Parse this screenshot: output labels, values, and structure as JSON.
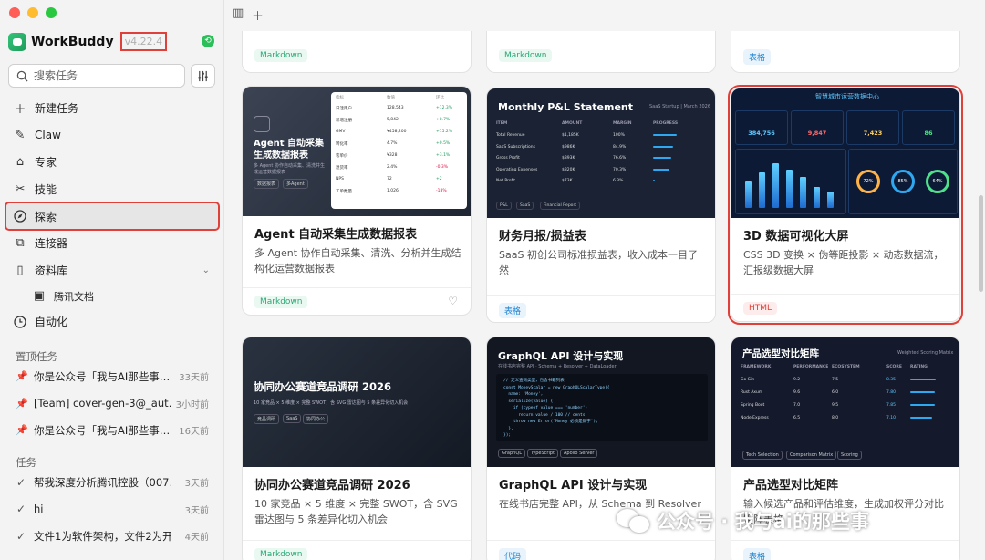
{
  "app": {
    "name": "WorkBuddy",
    "version": "v4.22.4"
  },
  "search": {
    "placeholder": "搜索任务"
  },
  "nav": [
    {
      "label": "新建任务",
      "icon": "plus-icon"
    },
    {
      "label": "Claw",
      "icon": "claw-icon"
    },
    {
      "label": "专家",
      "icon": "expert-hat-icon"
    },
    {
      "label": "技能",
      "icon": "skill-tools-icon"
    },
    {
      "label": "探索",
      "icon": "compass-icon",
      "active": true
    },
    {
      "label": "连接器",
      "icon": "connector-icon"
    },
    {
      "label": "资料库",
      "icon": "book-icon"
    },
    {
      "label": "腾讯文档",
      "icon": "doc-icon"
    },
    {
      "label": "自动化",
      "icon": "clock-icon"
    }
  ],
  "pinned": {
    "title": "置顶任务",
    "items": [
      {
        "title": "你是公众号「我与AI那些事…",
        "time": "33天前"
      },
      {
        "title": "[Team] cover-gen-3@_aut…",
        "time": "3小时前"
      },
      {
        "title": "你是公众号「我与AI那些事…",
        "time": "16天前"
      }
    ]
  },
  "tasks": {
    "title": "任务",
    "items": [
      {
        "title": "帮我深度分析腾讯控股（007…",
        "time": "3天前"
      },
      {
        "title": "hi",
        "time": "3天前"
      },
      {
        "title": "文件1为软件架构，文件2为开…",
        "time": "4天前"
      }
    ]
  },
  "top_row_tags": [
    "Markdown",
    "Markdown",
    "表格"
  ],
  "cards": [
    {
      "title": "Agent 自动采集生成数据报表",
      "desc": "多 Agent 协作自动采集、清洗、分析并生成结构化运营数据报表",
      "tag": "Markdown",
      "thumb_title": "Agent 自动采集生成数据报表",
      "thumb_sub": "多 Agent 协作自动采集、清洗并生成运营数据报表",
      "chips": [
        "数据报表",
        "多Agent"
      ],
      "table_headers": [
        "指标",
        "数值",
        "环比"
      ],
      "table_rows": [
        [
          "日活用户",
          "128,543",
          "+12.3%"
        ],
        [
          "新增注册",
          "5,842",
          "+8.7%"
        ],
        [
          "GMV",
          "¥458,200",
          "+15.2%"
        ],
        [
          "转化率",
          "4.7%",
          "+0.5%"
        ],
        [
          "客单价",
          "¥328",
          "+3.1%"
        ],
        [
          "退货率",
          "2.4%",
          "-0.3%"
        ],
        [
          "NPS",
          "72",
          "+2"
        ],
        [
          "工单数量",
          "1,026",
          "-18%"
        ]
      ]
    },
    {
      "title": "财务月报/损益表",
      "desc": "SaaS 初创公司标准损益表，收入成本一目了然",
      "tag": "表格",
      "thumb_title": "Monthly P&L Statement",
      "thumb_meta": "SaaS Startup | March 2026",
      "table_headers": [
        "ITEM",
        "AMOUNT",
        "MARGIN",
        "PROGRESS"
      ],
      "table_rows": [
        [
          "Total Revenue",
          "$1,185K",
          "100%"
        ],
        [
          "SaaS Subscriptions",
          "$986K",
          "84.9%"
        ],
        [
          "Gross Profit",
          "$893K",
          "76.6%"
        ],
        [
          "Operating Expenses",
          "$820K",
          "70.3%"
        ],
        [
          "Net Profit",
          "$73K",
          "6.3%"
        ]
      ],
      "progress": [
        1.0,
        0.849,
        0.766,
        0.703,
        0.063
      ],
      "chips": [
        "P&L",
        "SaaS",
        "Financial Report"
      ]
    },
    {
      "title": "3D 数据可视化大屏",
      "desc": "CSS 3D 变换 × 伪等距投影 × 动态数据流，汇报级数据大屏",
      "tag": "HTML",
      "highlight": true,
      "thumb_title": "智慧城市运营数据中心",
      "kpis": [
        "384,756",
        "9,847",
        "7,423",
        "86"
      ],
      "bar_levels": [
        0.55,
        0.75,
        0.95,
        0.8,
        0.65,
        0.45,
        0.35
      ],
      "rings": [
        "72%",
        "85%",
        "64%"
      ]
    },
    {
      "title": "协同办公赛道竞品调研 2026",
      "desc": "10 家竞品 × 5 维度 × 完整 SWOT，含 SVG 雷达图与 5 条差异化切入机会",
      "tag": "Markdown",
      "thumb_title": "协同办公赛道竞品调研 2026",
      "thumb_sub": "10 家竞品 × 5 维度 × 完整 SWOT，含 SVG 雷达图与 5 条差异化切入机会",
      "chips": [
        "竞品调研",
        "SaaS",
        "协同办公"
      ]
    },
    {
      "title": "GraphQL API 设计与实现",
      "desc": "在线书店完整 API，从 Schema 到 Resolver",
      "tag": "代码",
      "thumb_title": "GraphQL API 设计与实现",
      "thumb_sub": "在线书店完整 API · Schema + Resolver + DataLoader",
      "code": [
        "// 定义查询类型，包含书籍列表",
        "const MoneyScalar = new GraphQLScalarType({",
        "  name: 'Money',",
        "  serialize(value) {",
        "    if (typeof value === 'number')",
        "      return value / 100 // cents",
        "    throw new Error('Money 必须是数字');",
        "  },",
        "});"
      ],
      "chips": [
        "GraphQL",
        "TypeScript",
        "Apollo Server"
      ]
    },
    {
      "title": "产品选型对比矩阵",
      "desc": "输入候选产品和评估维度，生成加权评分对比矩阵表格",
      "tag": "表格",
      "thumb_title": "产品选型对比矩阵",
      "thumb_meta": "Weighted Scoring Matrix",
      "table_headers": [
        "FRAMEWORK",
        "PERFORMANCE",
        "ECOSYSTEM",
        "SCORE",
        "RATING"
      ],
      "table_rows": [
        [
          "Go Gin",
          "9.2",
          "7.5",
          "8.35"
        ],
        [
          "Rust Axum",
          "9.6",
          "6.0",
          "7.80"
        ],
        [
          "Spring Boot",
          "7.0",
          "9.5",
          "7.85"
        ],
        [
          "Node Express",
          "6.5",
          "8.0",
          "7.10"
        ]
      ],
      "ratings": [
        0.835,
        0.78,
        0.785,
        0.71
      ],
      "chips": [
        "Tech Selection",
        "Comparison Matrix",
        "Scoring"
      ]
    }
  ],
  "watermark": "公众号 · 我与ai的那些事",
  "colors": {
    "accent_red": "#e0403a",
    "brand_green": "#2bbf5a",
    "chart_blue": "#2ea8f0"
  }
}
